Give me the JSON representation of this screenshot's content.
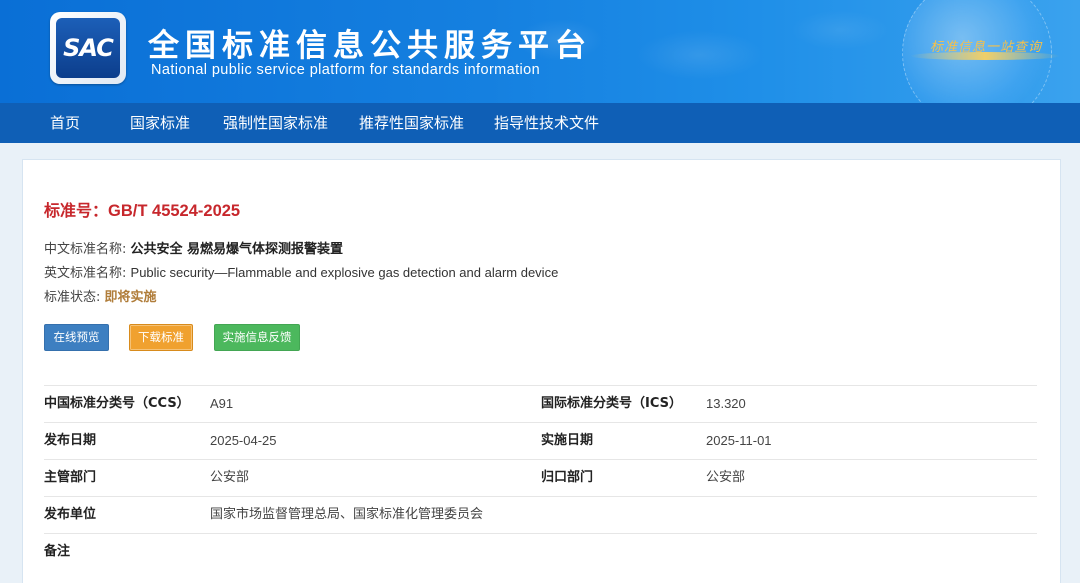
{
  "header": {
    "logo_text": "SAC",
    "title": "全国标准信息公共服务平台",
    "subtitle": "National public service platform  for standards information",
    "slogan": "标准信息一站查询",
    "colors": {
      "banner": "#1580e0",
      "nav": "#0f5fb6"
    }
  },
  "nav": {
    "items": [
      "首页",
      "国家标准",
      "强制性国家标准",
      "推荐性国家标准",
      "指导性技术文件"
    ]
  },
  "standard": {
    "number_label": "标准号：",
    "number": "GB/T 45524-2025",
    "cn_name_label": "中文标准名称:",
    "cn_name": "公共安全 易燃易爆气体探测报警装置",
    "en_name_label": "英文标准名称:",
    "en_name": "Public security—Flammable and explosive gas detection and alarm device",
    "status_label": "标准状态:",
    "status": "即将实施"
  },
  "buttons": {
    "preview": "在线预览",
    "download": "下载标准",
    "feedback": "实施信息反馈"
  },
  "details": [
    {
      "k1": "中国标准分类号（CCS）",
      "v1": "A91",
      "k2": "国际标准分类号（ICS）",
      "v2": "13.320"
    },
    {
      "k1": "发布日期",
      "v1": "2025-04-25",
      "k2": "实施日期",
      "v2": "2025-11-01"
    },
    {
      "k1": "主管部门",
      "v1": "公安部",
      "k2": "归口部门",
      "v2": "公安部"
    },
    {
      "k1": "发布单位",
      "v1": "国家市场监督管理总局、国家标准化管理委员会",
      "k2": "",
      "v2": ""
    },
    {
      "k1": "备注",
      "v1": "",
      "k2": "",
      "v2": ""
    }
  ]
}
